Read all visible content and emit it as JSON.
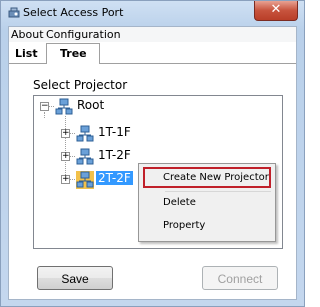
{
  "window": {
    "title": "Select Access Port",
    "close_glyph": "✕"
  },
  "menu": [
    "About",
    "Configuration"
  ],
  "tabs": {
    "list": "List",
    "tree": "Tree"
  },
  "section_label": "Select Projector",
  "tree": {
    "root": {
      "label": "Root",
      "expander": "−"
    },
    "children": [
      {
        "label": "1T-1F",
        "expander": "+"
      },
      {
        "label": "1T-2F",
        "expander": "+"
      },
      {
        "label": "2T-2F",
        "expander": "+",
        "selected": true
      }
    ]
  },
  "context_menu": {
    "items": [
      "Create New Projector",
      "Delete",
      "Property"
    ],
    "highlight_color": "#c0202a"
  },
  "buttons": {
    "save": "Save",
    "connect": "Connect"
  },
  "colors": {
    "selection": "#3399ff",
    "close": "#c7533d"
  },
  "icons": {
    "app": "projector-icon",
    "node": "projector-network-icon"
  }
}
